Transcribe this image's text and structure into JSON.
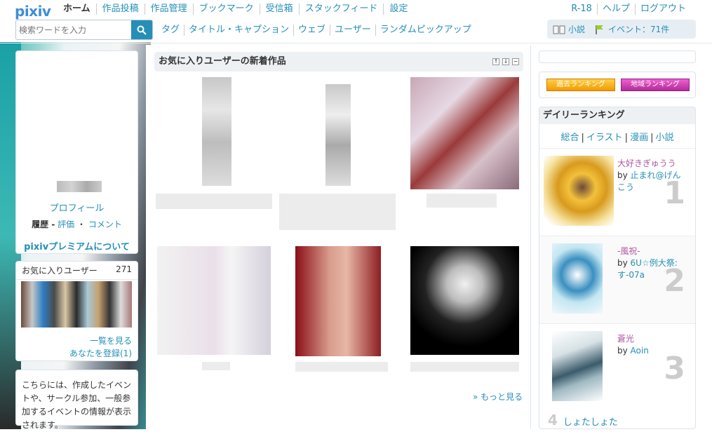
{
  "header": {
    "logo": "pixiv",
    "nav": [
      "ホーム",
      "作品投稿",
      "作品管理",
      "ブックマーク",
      "受信箱",
      "スタックフィード",
      "設定"
    ],
    "right_nav": [
      "R-18",
      "ヘルプ",
      "ログアウト"
    ],
    "search_placeholder": "検索ワードを入力",
    "subnav": [
      "タグ",
      "タイトル・キャプション",
      "ウェブ",
      "ユーザー",
      "ランダムピックアップ"
    ],
    "info_novel": "小説",
    "info_event": "イベント：71件"
  },
  "left": {
    "profile_link": "プロフィール",
    "history_label": "履歴 -",
    "history_eval": "評価",
    "history_sep": "・",
    "history_comment": "コメント",
    "premium": "pixivプレミアムについて",
    "fav_users_label": "お気に入りユーザー",
    "fav_users_count": "271",
    "see_all": "一覧を見る",
    "registered": "あなたを登録(1)",
    "events_text": "こちらには、作成したイベントや、サークル参加、一般参加するイベントの情報が表示されます。"
  },
  "center": {
    "section_title": "お気に入りユーザーの新着作品",
    "more": "» もっと見る"
  },
  "right": {
    "past_ranking": "過去ランキング",
    "region_ranking": "地域ランキング",
    "daily_title": "デイリーランキング",
    "tabs": [
      "総合",
      "イラスト",
      "漫画",
      "小説"
    ],
    "ranks": [
      {
        "num": "1",
        "title": "大好きぎゅうう",
        "by": "by",
        "author": "止まれ@げんこう"
      },
      {
        "num": "2",
        "title": "-風祝-",
        "by": "by",
        "author": "6U☆例大祭: す-07a"
      },
      {
        "num": "3",
        "title": "蒼光",
        "by": "by",
        "author": "Aoin"
      }
    ],
    "rank4_num": "4",
    "rank4_title": "しょたしょた"
  }
}
